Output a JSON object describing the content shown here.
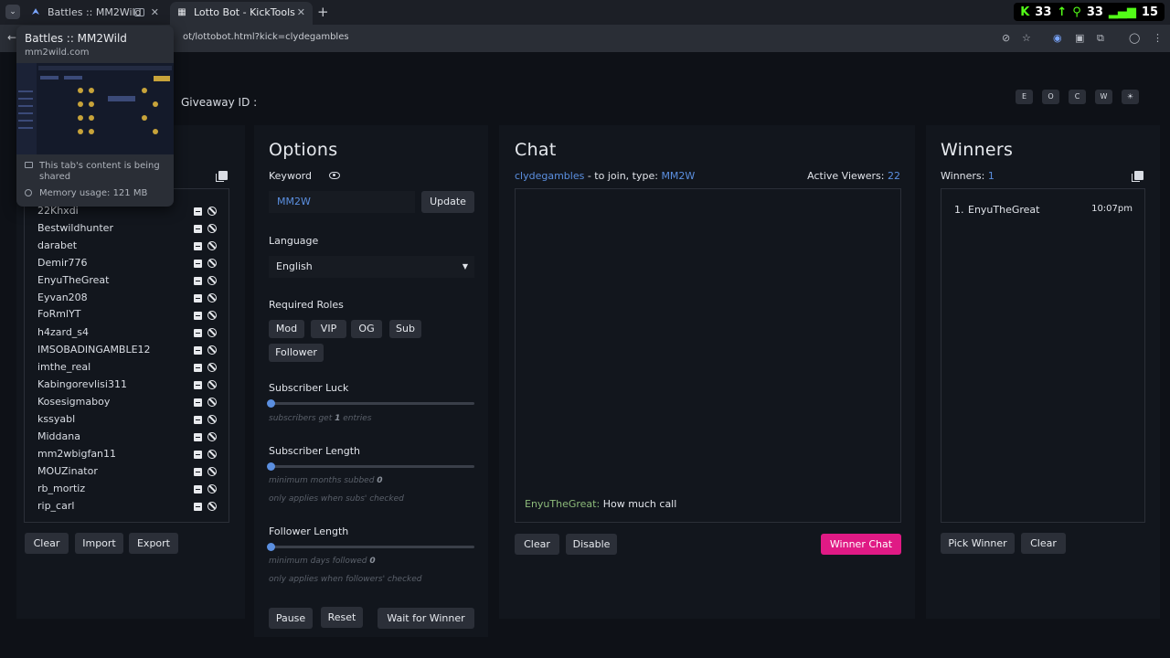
{
  "browser": {
    "tabs": [
      {
        "title": "Battles :: MM2Wild",
        "icon": "mm2wild-favicon"
      },
      {
        "title": "Lotto Bot - KickTools",
        "icon": "kicktools-favicon"
      }
    ],
    "url_visible": "ot/lottobot.html?kick=clydegambles",
    "new_tab_label": "+"
  },
  "system_tray": {
    "kick_count": "33",
    "followers": "33",
    "signal": "15"
  },
  "tooltip": {
    "title": "Battles :: MM2Wild",
    "host": "mm2wild.com",
    "sharing_note": "This tab's content is being shared",
    "memory": "Memory usage: 121 MB"
  },
  "header": {
    "giveaway_label": "Giveaway ID :",
    "theme_buttons": [
      "E",
      "O",
      "C",
      "W",
      "☀"
    ]
  },
  "users": {
    "list": [
      "22Khxdi",
      "Bestwildhunter",
      "darabet",
      "Demir776",
      "EnyuTheGreat",
      "Eyvan208",
      "FoRmlYT",
      "h4zard_s4",
      "IMSOBADINGAMBLE12",
      "imthe_real",
      "Kabingorevlisi311",
      "Kosesigmaboy",
      "kssyabl",
      "Middana",
      "mm2wbigfan11",
      "MOUZinator",
      "rb_mortiz",
      "rip_carl"
    ],
    "buttons": {
      "clear": "Clear",
      "import": "Import",
      "export": "Export"
    }
  },
  "options": {
    "title": "Options",
    "keyword_label": "Keyword",
    "keyword_value": "MM2W",
    "update_label": "Update",
    "language_label": "Language",
    "language_value": "English",
    "roles_label": "Required Roles",
    "roles": [
      "Mod",
      "VIP",
      "OG",
      "Sub",
      "Follower"
    ],
    "sub_luck_label": "Subscriber Luck",
    "sub_luck_hint_pre": "subscribers get",
    "sub_luck_value": "1",
    "sub_luck_hint_post": "entries",
    "sub_length_label": "Subscriber Length",
    "sub_length_hint": "minimum months subbed",
    "sub_length_value": "0",
    "sub_length_note": "only applies when subs' checked",
    "follow_length_label": "Follower Length",
    "follow_length_hint": "minimum days followed",
    "follow_length_value": "0",
    "follow_length_note": "only applies when followers' checked",
    "pause_label": "Pause",
    "reset_label": "Reset",
    "wait_label": "Wait for Winner"
  },
  "chat": {
    "title": "Chat",
    "channel": "clydegambles",
    "join_text": " - to join, type: ",
    "join_keyword": "MM2W",
    "viewers_label": "Active Viewers:",
    "viewers_count": "22",
    "message_user": "EnyuTheGreat:",
    "message_text": " How much call",
    "clear_label": "Clear",
    "disable_label": "Disable",
    "winner_chat_label": "Winner Chat"
  },
  "winners": {
    "title": "Winners",
    "count_label": "Winners:",
    "count": "1",
    "list": [
      {
        "rank": "1.",
        "name": "EnyuTheGreat",
        "time": "10:07pm"
      }
    ],
    "pick_label": "Pick Winner",
    "clear_label": "Clear"
  }
}
